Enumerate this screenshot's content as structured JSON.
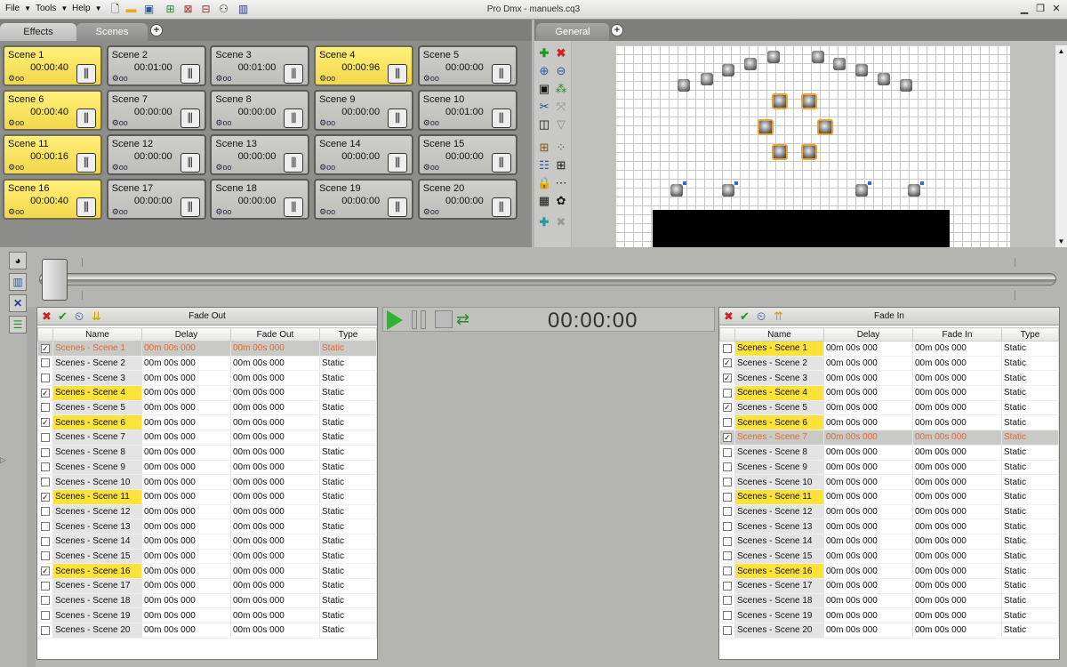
{
  "window": {
    "title": "Pro Dmx - manuels.cq3"
  },
  "menu": [
    {
      "label": "File"
    },
    {
      "label": "Tools"
    },
    {
      "label": "Help"
    }
  ],
  "left_tabs": [
    {
      "label": "Effects"
    },
    {
      "label": "Scenes"
    }
  ],
  "right_tabs": [
    {
      "label": "General"
    }
  ],
  "scenes": [
    {
      "name": "Scene 1",
      "time": "00:00:40",
      "loop": "oo",
      "active": true
    },
    {
      "name": "Scene 2",
      "time": "00:01:00",
      "loop": "oo",
      "active": false
    },
    {
      "name": "Scene 3",
      "time": "00:01:00",
      "loop": "oo",
      "active": false
    },
    {
      "name": "Scene 4",
      "time": "00:00:96",
      "loop": "oo",
      "active": true
    },
    {
      "name": "Scene 5",
      "time": "00:00:00",
      "loop": "oo",
      "active": false
    },
    {
      "name": "Scene 6",
      "time": "00:00:40",
      "loop": "oo",
      "active": true
    },
    {
      "name": "Scene 7",
      "time": "00:00:00",
      "loop": "oo",
      "active": false
    },
    {
      "name": "Scene 8",
      "time": "00:00:00",
      "loop": "oo",
      "active": false
    },
    {
      "name": "Scene 9",
      "time": "00:00:00",
      "loop": "oo",
      "active": false
    },
    {
      "name": "Scene 10",
      "time": "00:01:00",
      "loop": "oo",
      "active": false
    },
    {
      "name": "Scene 11",
      "time": "00:00:16",
      "loop": "oo",
      "active": true
    },
    {
      "name": "Scene 12",
      "time": "00:00:00",
      "loop": "oo",
      "active": false
    },
    {
      "name": "Scene 13",
      "time": "00:00:00",
      "loop": "oo",
      "active": false
    },
    {
      "name": "Scene 14",
      "time": "00:00:00",
      "loop": "oo",
      "active": false
    },
    {
      "name": "Scene 15",
      "time": "00:00:00",
      "loop": "oo",
      "active": false
    },
    {
      "name": "Scene 16",
      "time": "00:00:40",
      "loop": "oo",
      "active": true
    },
    {
      "name": "Scene 17",
      "time": "00:00:00",
      "loop": "oo",
      "active": false
    },
    {
      "name": "Scene 18",
      "time": "00:00:00",
      "loop": "oo",
      "active": false
    },
    {
      "name": "Scene 19",
      "time": "00:00:00",
      "loop": "oo",
      "active": false
    },
    {
      "name": "Scene 20",
      "time": "00:00:00",
      "loop": "oo",
      "active": false
    }
  ],
  "fade_out": {
    "title": "Fade Out",
    "columns": [
      "Name",
      "Delay",
      "Fade Out",
      "Type"
    ],
    "rows": [
      {
        "name": "Scenes - Scene 1",
        "delay": "00m 00s 000",
        "fade": "00m 00s 000",
        "type": "Static",
        "checked": true,
        "highlight": false,
        "selected": true
      },
      {
        "name": "Scenes - Scene 2",
        "delay": "00m 00s 000",
        "fade": "00m 00s 000",
        "type": "Static",
        "checked": false,
        "highlight": false,
        "selected": false
      },
      {
        "name": "Scenes - Scene 3",
        "delay": "00m 00s 000",
        "fade": "00m 00s 000",
        "type": "Static",
        "checked": false,
        "highlight": false,
        "selected": false
      },
      {
        "name": "Scenes - Scene 4",
        "delay": "00m 00s 000",
        "fade": "00m 00s 000",
        "type": "Static",
        "checked": true,
        "highlight": true,
        "selected": false
      },
      {
        "name": "Scenes - Scene 5",
        "delay": "00m 00s 000",
        "fade": "00m 00s 000",
        "type": "Static",
        "checked": false,
        "highlight": false,
        "selected": false
      },
      {
        "name": "Scenes - Scene 6",
        "delay": "00m 00s 000",
        "fade": "00m 00s 000",
        "type": "Static",
        "checked": true,
        "highlight": true,
        "selected": false
      },
      {
        "name": "Scenes - Scene 7",
        "delay": "00m 00s 000",
        "fade": "00m 00s 000",
        "type": "Static",
        "checked": false,
        "highlight": false,
        "selected": false
      },
      {
        "name": "Scenes - Scene 8",
        "delay": "00m 00s 000",
        "fade": "00m 00s 000",
        "type": "Static",
        "checked": false,
        "highlight": false,
        "selected": false
      },
      {
        "name": "Scenes - Scene 9",
        "delay": "00m 00s 000",
        "fade": "00m 00s 000",
        "type": "Static",
        "checked": false,
        "highlight": false,
        "selected": false
      },
      {
        "name": "Scenes - Scene 10",
        "delay": "00m 00s 000",
        "fade": "00m 00s 000",
        "type": "Static",
        "checked": false,
        "highlight": false,
        "selected": false
      },
      {
        "name": "Scenes - Scene 11",
        "delay": "00m 00s 000",
        "fade": "00m 00s 000",
        "type": "Static",
        "checked": true,
        "highlight": true,
        "selected": false
      },
      {
        "name": "Scenes - Scene 12",
        "delay": "00m 00s 000",
        "fade": "00m 00s 000",
        "type": "Static",
        "checked": false,
        "highlight": false,
        "selected": false
      },
      {
        "name": "Scenes - Scene 13",
        "delay": "00m 00s 000",
        "fade": "00m 00s 000",
        "type": "Static",
        "checked": false,
        "highlight": false,
        "selected": false
      },
      {
        "name": "Scenes - Scene 14",
        "delay": "00m 00s 000",
        "fade": "00m 00s 000",
        "type": "Static",
        "checked": false,
        "highlight": false,
        "selected": false
      },
      {
        "name": "Scenes - Scene 15",
        "delay": "00m 00s 000",
        "fade": "00m 00s 000",
        "type": "Static",
        "checked": false,
        "highlight": false,
        "selected": false
      },
      {
        "name": "Scenes - Scene 16",
        "delay": "00m 00s 000",
        "fade": "00m 00s 000",
        "type": "Static",
        "checked": true,
        "highlight": true,
        "selected": false
      },
      {
        "name": "Scenes - Scene 17",
        "delay": "00m 00s 000",
        "fade": "00m 00s 000",
        "type": "Static",
        "checked": false,
        "highlight": false,
        "selected": false
      },
      {
        "name": "Scenes - Scene 18",
        "delay": "00m 00s 000",
        "fade": "00m 00s 000",
        "type": "Static",
        "checked": false,
        "highlight": false,
        "selected": false
      },
      {
        "name": "Scenes - Scene 19",
        "delay": "00m 00s 000",
        "fade": "00m 00s 000",
        "type": "Static",
        "checked": false,
        "highlight": false,
        "selected": false
      },
      {
        "name": "Scenes - Scene 20",
        "delay": "00m 00s 000",
        "fade": "00m 00s 000",
        "type": "Static",
        "checked": false,
        "highlight": false,
        "selected": false
      }
    ]
  },
  "fade_in": {
    "title": "Fade In",
    "columns": [
      "Name",
      "Delay",
      "Fade In",
      "Type"
    ],
    "rows": [
      {
        "name": "Scenes - Scene 1",
        "delay": "00m 00s 000",
        "fade": "00m 00s 000",
        "type": "Static",
        "checked": false,
        "highlight": true,
        "selected": false
      },
      {
        "name": "Scenes - Scene 2",
        "delay": "00m 00s 000",
        "fade": "00m 00s 000",
        "type": "Static",
        "checked": true,
        "highlight": false,
        "selected": false
      },
      {
        "name": "Scenes - Scene 3",
        "delay": "00m 00s 000",
        "fade": "00m 00s 000",
        "type": "Static",
        "checked": true,
        "highlight": false,
        "selected": false
      },
      {
        "name": "Scenes - Scene 4",
        "delay": "00m 00s 000",
        "fade": "00m 00s 000",
        "type": "Static",
        "checked": false,
        "highlight": true,
        "selected": false
      },
      {
        "name": "Scenes - Scene 5",
        "delay": "00m 00s 000",
        "fade": "00m 00s 000",
        "type": "Static",
        "checked": true,
        "highlight": false,
        "selected": false
      },
      {
        "name": "Scenes - Scene 6",
        "delay": "00m 00s 000",
        "fade": "00m 00s 000",
        "type": "Static",
        "checked": false,
        "highlight": true,
        "selected": false
      },
      {
        "name": "Scenes - Scene 7",
        "delay": "00m 00s 000",
        "fade": "00m 00s 000",
        "type": "Static",
        "checked": true,
        "highlight": false,
        "selected": true
      },
      {
        "name": "Scenes - Scene 8",
        "delay": "00m 00s 000",
        "fade": "00m 00s 000",
        "type": "Static",
        "checked": false,
        "highlight": false,
        "selected": false
      },
      {
        "name": "Scenes - Scene 9",
        "delay": "00m 00s 000",
        "fade": "00m 00s 000",
        "type": "Static",
        "checked": false,
        "highlight": false,
        "selected": false
      },
      {
        "name": "Scenes - Scene 10",
        "delay": "00m 00s 000",
        "fade": "00m 00s 000",
        "type": "Static",
        "checked": false,
        "highlight": false,
        "selected": false
      },
      {
        "name": "Scenes - Scene 11",
        "delay": "00m 00s 000",
        "fade": "00m 00s 000",
        "type": "Static",
        "checked": false,
        "highlight": true,
        "selected": false
      },
      {
        "name": "Scenes - Scene 12",
        "delay": "00m 00s 000",
        "fade": "00m 00s 000",
        "type": "Static",
        "checked": false,
        "highlight": false,
        "selected": false
      },
      {
        "name": "Scenes - Scene 13",
        "delay": "00m 00s 000",
        "fade": "00m 00s 000",
        "type": "Static",
        "checked": false,
        "highlight": false,
        "selected": false
      },
      {
        "name": "Scenes - Scene 14",
        "delay": "00m 00s 000",
        "fade": "00m 00s 000",
        "type": "Static",
        "checked": false,
        "highlight": false,
        "selected": false
      },
      {
        "name": "Scenes - Scene 15",
        "delay": "00m 00s 000",
        "fade": "00m 00s 000",
        "type": "Static",
        "checked": false,
        "highlight": false,
        "selected": false
      },
      {
        "name": "Scenes - Scene 16",
        "delay": "00m 00s 000",
        "fade": "00m 00s 000",
        "type": "Static",
        "checked": false,
        "highlight": true,
        "selected": false
      },
      {
        "name": "Scenes - Scene 17",
        "delay": "00m 00s 000",
        "fade": "00m 00s 000",
        "type": "Static",
        "checked": false,
        "highlight": false,
        "selected": false
      },
      {
        "name": "Scenes - Scene 18",
        "delay": "00m 00s 000",
        "fade": "00m 00s 000",
        "type": "Static",
        "checked": false,
        "highlight": false,
        "selected": false
      },
      {
        "name": "Scenes - Scene 19",
        "delay": "00m 00s 000",
        "fade": "00m 00s 000",
        "type": "Static",
        "checked": false,
        "highlight": false,
        "selected": false
      },
      {
        "name": "Scenes - Scene 20",
        "delay": "00m 00s 000",
        "fade": "00m 00s 000",
        "type": "Static",
        "checked": false,
        "highlight": false,
        "selected": false
      }
    ]
  },
  "transport": {
    "time": "00:00:00"
  },
  "colors": {
    "scene_active": "#f3d74a",
    "row_highlight": "#fde23a",
    "selected_text": "#e06a3a",
    "play_green": "#2db52d"
  },
  "icons": [
    "new-file-icon",
    "open-folder-icon",
    "save-icon",
    "import-icon",
    "export-icon",
    "dmx-icon",
    "chart-icon",
    "add-icon",
    "delete-icon",
    "zoom-in-icon",
    "zoom-out-icon",
    "play-icon",
    "pause-icon",
    "stop-icon"
  ]
}
